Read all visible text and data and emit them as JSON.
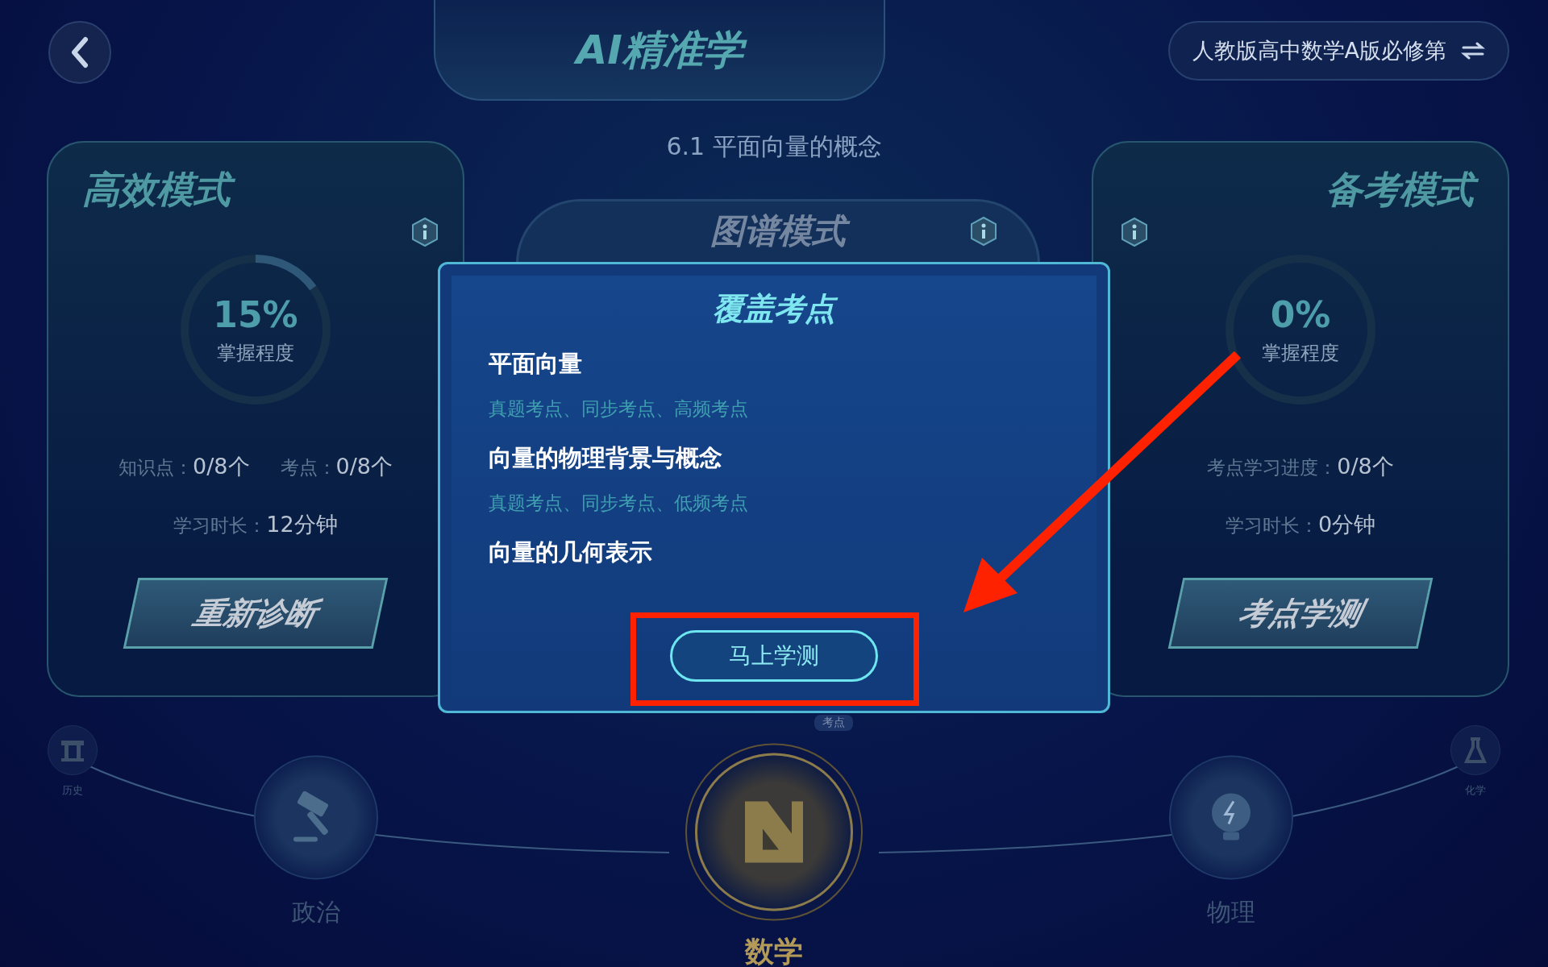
{
  "header": {
    "title": "AI精准学",
    "textbook": "人教版高中数学A版必修第"
  },
  "section_title": "6.1 平面向量的概念",
  "modes": [
    {
      "kind": "left",
      "title": "高效模式",
      "percent": "15%",
      "level": 0.15,
      "caption": "掌握程度",
      "stat_rows": [
        [
          {
            "label": "知识点：",
            "value": "0/8个"
          },
          {
            "label": "考点：",
            "value": "0/8个"
          }
        ],
        [
          {
            "label": "学习时长：",
            "value": "12分钟"
          }
        ]
      ],
      "button": "重新诊断"
    },
    {
      "kind": "right",
      "title": "备考模式",
      "percent": "0%",
      "level": 0,
      "caption": "掌握程度",
      "stat_rows": [
        [
          {
            "label": "考点学习进度：",
            "value": "0/8个"
          }
        ],
        [
          {
            "label": "学习时长：",
            "value": "0分钟"
          }
        ]
      ],
      "button": "考点学测"
    }
  ],
  "center_tab": {
    "title": "图谱模式"
  },
  "graph_tag": "考点",
  "dialog": {
    "title": "覆盖考点",
    "items": [
      {
        "name": "平面向量",
        "tags": "真题考点、同步考点、高频考点"
      },
      {
        "name": "向量的物理背景与概念",
        "tags": "真题考点、同步考点、低频考点"
      },
      {
        "name": "向量的几何表示"
      }
    ],
    "button": "马上学测"
  },
  "subjects": [
    {
      "kind": "far",
      "name": "历史",
      "selected": false
    },
    {
      "kind": "near",
      "name": "政治",
      "selected": false
    },
    {
      "kind": "near",
      "name": "数学",
      "selected": true
    },
    {
      "kind": "near",
      "name": "物理",
      "selected": false
    },
    {
      "kind": "far",
      "name": "化学",
      "selected": false
    }
  ]
}
